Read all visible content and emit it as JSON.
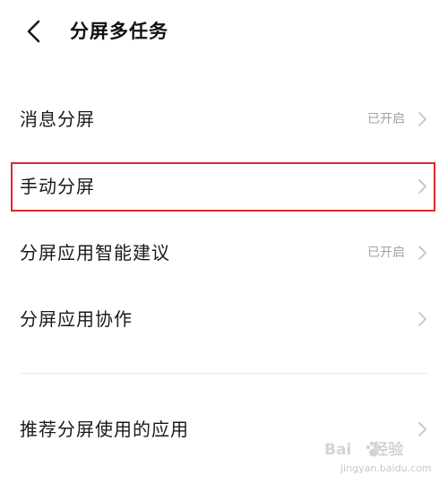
{
  "header": {
    "title": "分屏多任务",
    "back_icon": "back-arrow-icon"
  },
  "settings": {
    "items": [
      {
        "label": "消息分屏",
        "status": "已开启"
      },
      {
        "label": "手动分屏",
        "status": ""
      },
      {
        "label": "分屏应用智能建议",
        "status": "已开启"
      },
      {
        "label": "分屏应用协作",
        "status": ""
      },
      {
        "label": "推荐分屏使用的应用",
        "status": ""
      }
    ]
  },
  "highlight": {
    "color": "#e0282e",
    "target_label": "手动分屏"
  },
  "watermark": {
    "brand_left": "Bai",
    "brand_right": "经验",
    "url": "jingyan.baidu.com"
  },
  "colors": {
    "text": "#1a1a1a",
    "status_text": "#a3a3a3",
    "chevron": "#c4c4c4"
  }
}
